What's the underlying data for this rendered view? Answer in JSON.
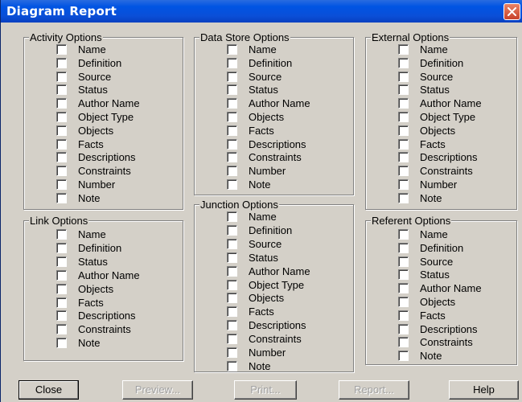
{
  "window": {
    "title": "Diagram Report"
  },
  "groups": {
    "activity": {
      "title": "Activity Options",
      "items": [
        "Name",
        "Definition",
        "Source",
        "Status",
        "Author Name",
        "Object Type",
        "Objects",
        "Facts",
        "Descriptions",
        "Constraints",
        "Number",
        "Note"
      ]
    },
    "data_store": {
      "title": "Data Store Options",
      "items": [
        "Name",
        "Definition",
        "Source",
        "Status",
        "Author Name",
        "Objects",
        "Facts",
        "Descriptions",
        "Constraints",
        "Number",
        "Note"
      ]
    },
    "external": {
      "title": "External Options",
      "items": [
        "Name",
        "Definition",
        "Source",
        "Status",
        "Author Name",
        "Object Type",
        "Objects",
        "Facts",
        "Descriptions",
        "Constraints",
        "Number",
        "Note"
      ]
    },
    "link": {
      "title": "Link Options",
      "items": [
        "Name",
        "Definition",
        "Status",
        "Author Name",
        "Objects",
        "Facts",
        "Descriptions",
        "Constraints",
        "Note"
      ]
    },
    "junction": {
      "title": "Junction Options",
      "items": [
        "Name",
        "Definition",
        "Source",
        "Status",
        "Author Name",
        "Object Type",
        "Objects",
        "Facts",
        "Descriptions",
        "Constraints",
        "Number",
        "Note"
      ]
    },
    "referent": {
      "title": "Referent Options",
      "items": [
        "Name",
        "Definition",
        "Source",
        "Status",
        "Author Name",
        "Objects",
        "Facts",
        "Descriptions",
        "Constraints",
        "Note"
      ]
    }
  },
  "buttons": {
    "close": "Close",
    "preview": "Preview...",
    "print": "Print...",
    "report": "Report...",
    "help": "Help"
  },
  "colors": {
    "titlebar": "#0054e3",
    "dialog_bg": "#d4d0c8",
    "close_button": "#d6553a"
  }
}
